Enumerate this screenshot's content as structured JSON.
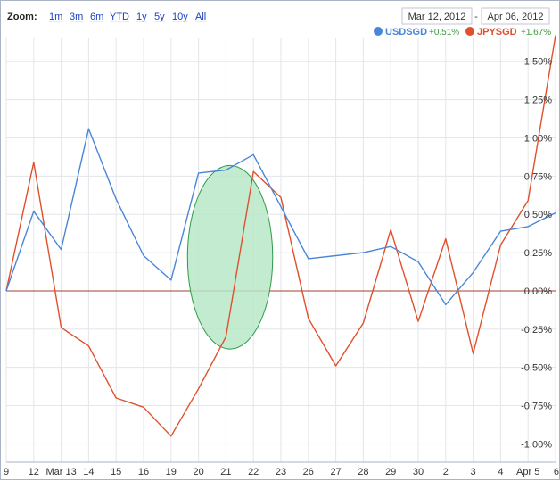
{
  "toolbar": {
    "zoom_label": "Zoom:",
    "zoom_options": [
      "1m",
      "3m",
      "6m",
      "YTD",
      "1y",
      "5y",
      "10y",
      "All"
    ],
    "date_from": "Mar 12, 2012",
    "date_separator": "-",
    "date_to": "Apr 06, 2012"
  },
  "colors": {
    "usdsgd": "#4a86d8",
    "jpysgd": "#e0502c",
    "change_positive": "#3a9b3a",
    "zero_line": "#a04030",
    "highlight_fill": "#b8e8c8",
    "highlight_stroke": "#2e9a48"
  },
  "chart_data": {
    "type": "line",
    "x_tick_labels": [
      "9",
      "12",
      "Mar 13",
      "14",
      "15",
      "16",
      "19",
      "20",
      "21",
      "22",
      "23",
      "26",
      "27",
      "28",
      "29",
      "30",
      "2",
      "3",
      "4",
      "Apr 5",
      "6"
    ],
    "y_tick_labels": [
      "1.50%",
      "1.25%",
      "1.00%",
      "0.75%",
      "0.50%",
      "0.25%",
      "0.00%",
      "-0.25%",
      "-0.50%",
      "-0.75%",
      "-1.00%"
    ],
    "ylim": [
      -1.12,
      1.65
    ],
    "grid": true,
    "legend_position": "top-right",
    "series": [
      {
        "name": "USDSGD",
        "change": "+0.51%",
        "color": "#4a86d8",
        "values": [
          0.0,
          0.52,
          0.27,
          1.06,
          0.6,
          0.23,
          0.07,
          0.77,
          0.79,
          0.89,
          0.55,
          0.21,
          0.23,
          0.25,
          0.29,
          0.19,
          -0.09,
          0.12,
          0.39,
          0.42,
          0.51
        ]
      },
      {
        "name": "JPYSGD",
        "change": "+1.67%",
        "color": "#e0502c",
        "values": [
          0.0,
          0.84,
          -0.24,
          -0.36,
          -0.7,
          -0.76,
          -0.95,
          -0.64,
          -0.3,
          0.78,
          0.61,
          -0.18,
          -0.49,
          -0.21,
          0.4,
          -0.2,
          0.34,
          -0.41,
          0.3,
          0.59,
          1.67
        ]
      }
    ],
    "annotation": {
      "type": "ellipse-highlight",
      "x_from": 6.6,
      "x_to": 9.7,
      "y_from": -0.38,
      "y_to": 0.82
    }
  }
}
